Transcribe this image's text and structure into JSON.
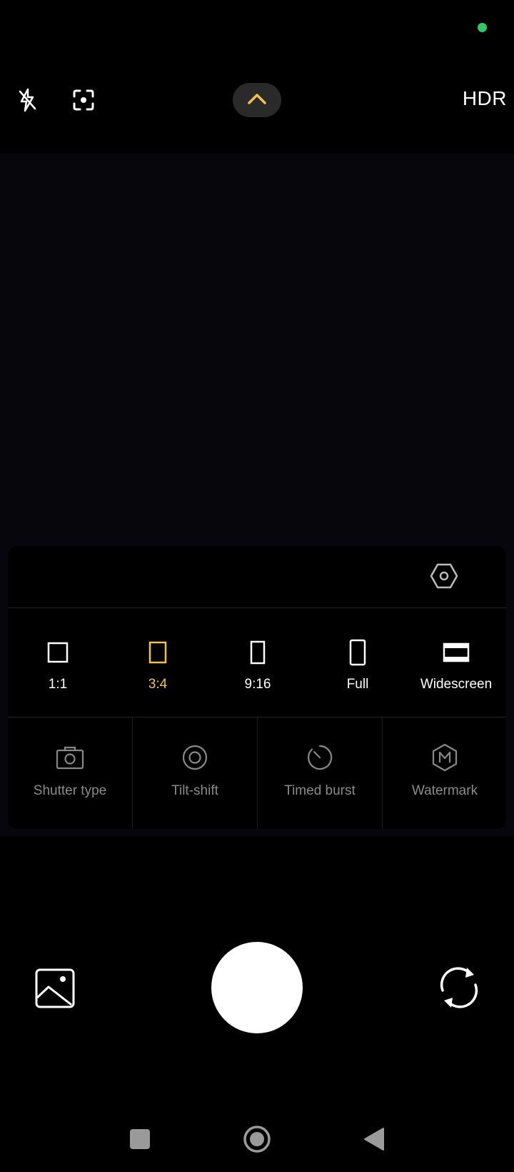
{
  "status": {
    "indicator_color": "#33c866"
  },
  "topbar": {
    "flash_icon": "flash-off-icon",
    "focus_icon": "focus-frame-icon",
    "expand_icon": "chevron-up-icon",
    "hdr_label": "HDR"
  },
  "panel": {
    "settings_icon": "hexagon-settings-icon",
    "aspect_ratios": [
      {
        "label": "1:1",
        "selected": false
      },
      {
        "label": "3:4",
        "selected": true
      },
      {
        "label": "9:16",
        "selected": false
      },
      {
        "label": "Full",
        "selected": false
      },
      {
        "label": "Widescreen",
        "selected": false
      }
    ],
    "tools": [
      {
        "label": "Shutter type",
        "icon": "camera-icon"
      },
      {
        "label": "Tilt-shift",
        "icon": "tilt-shift-icon"
      },
      {
        "label": "Timed burst",
        "icon": "timer-icon"
      },
      {
        "label": "Watermark",
        "icon": "watermark-icon"
      }
    ]
  },
  "bottom": {
    "gallery_icon": "gallery-icon",
    "shutter_icon": "shutter-button",
    "switch_icon": "switch-camera-icon"
  },
  "colors": {
    "accent": "#f2c14e",
    "inactive_text": "#8a8a8a"
  }
}
